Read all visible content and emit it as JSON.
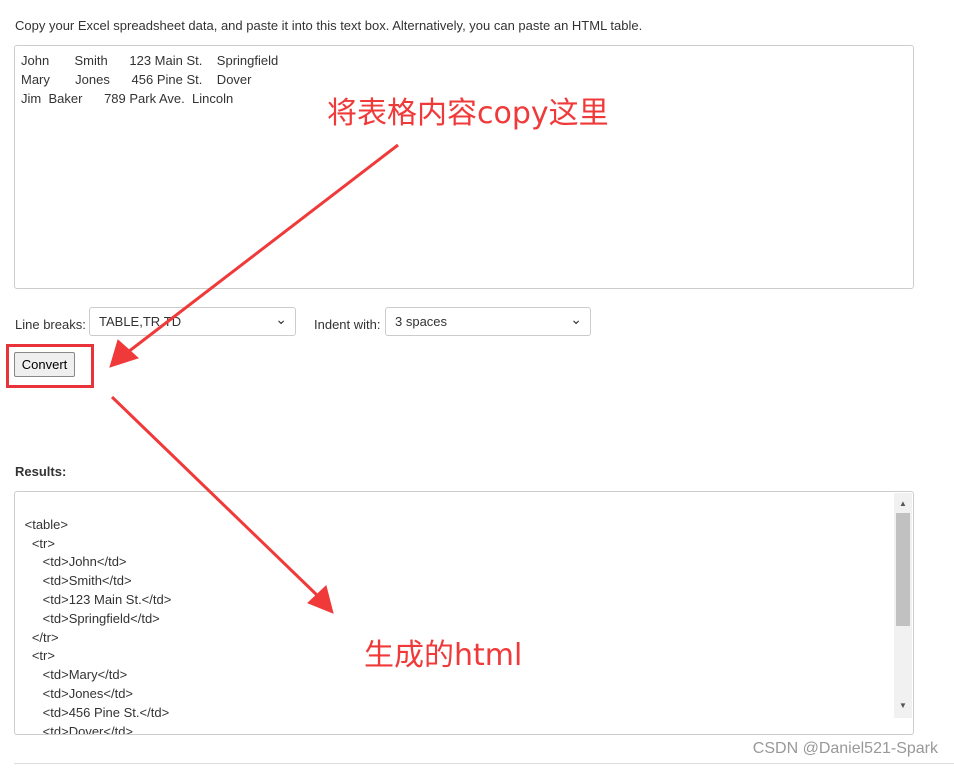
{
  "intro": "Copy your Excel spreadsheet data, and paste it into this text box. Alternatively, you can paste an HTML table.",
  "input": "John       Smith      123 Main St.    Springfield\nMary       Jones      456 Pine St.    Dover\nJim  Baker      789 Park Ave.  Lincoln",
  "line_breaks": {
    "label": "Line breaks:",
    "value": "TABLE,TR,TD"
  },
  "indent": {
    "label": "Indent with:",
    "value": "3 spaces"
  },
  "convert": "Convert",
  "results_label": "Results:",
  "output": "<table>\n   <tr>\n      <td>John</td>\n      <td>Smith</td>\n      <td>123 Main St.</td>\n      <td>Springfield</td>\n   </tr>\n   <tr>\n      <td>Mary</td>\n      <td>Jones</td>\n      <td>456 Pine St.</td>\n      <td>Dover</td>\n   </tr>",
  "annotations": {
    "paste": "将表格内容copy这里",
    "generated": "生成的html",
    "color": "#f03a3a"
  },
  "watermark": "CSDN @Daniel521-Spark"
}
